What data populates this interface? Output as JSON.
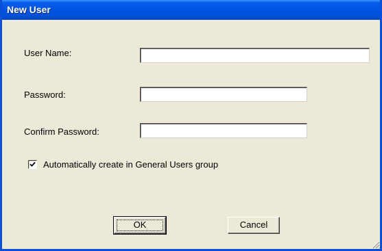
{
  "window": {
    "title": "New User"
  },
  "form": {
    "username_label": "User Name:",
    "username_value": "",
    "password_label": "Password:",
    "password_value": "",
    "confirm_label": "Confirm Password:",
    "confirm_value": "",
    "auto_group_label": "Automatically create in General Users group",
    "auto_group_checked": true
  },
  "buttons": {
    "ok_label": "OK",
    "cancel_label": "Cancel"
  },
  "colors": {
    "titlebar": "#0054e3",
    "dialog_background": "#ece9d8"
  }
}
